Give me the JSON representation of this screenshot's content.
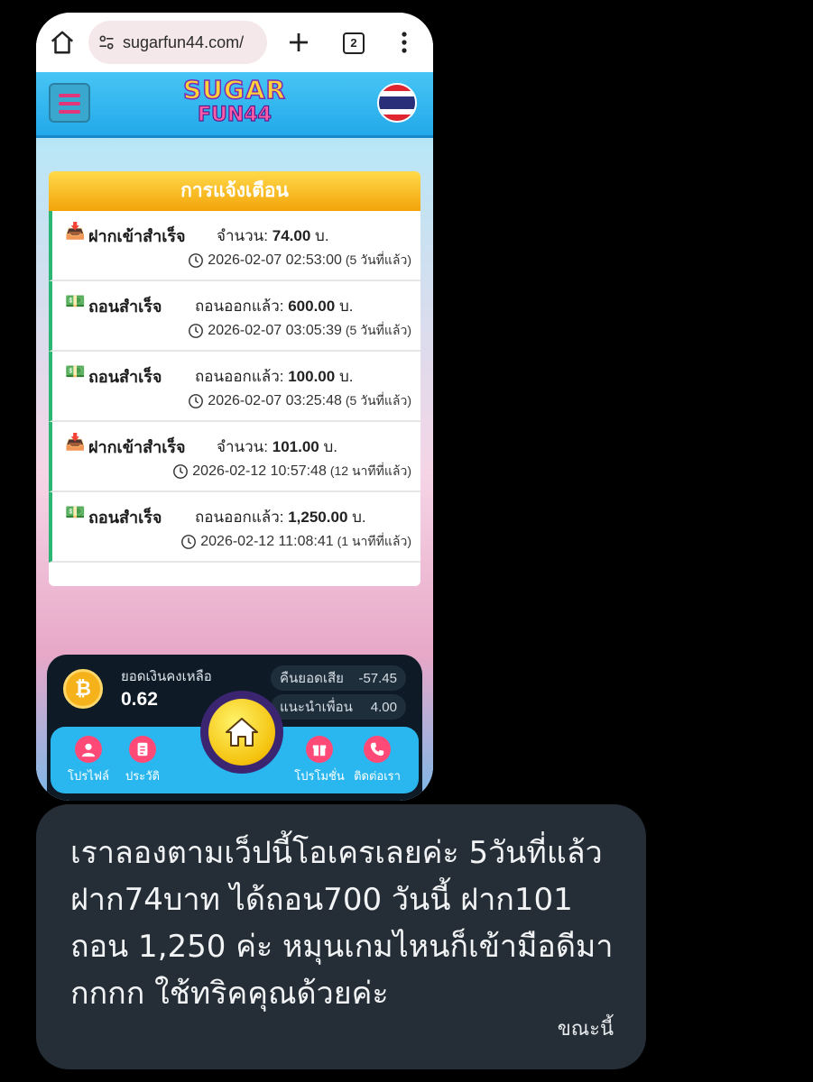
{
  "browser": {
    "url": "sugarfun44.com/",
    "tab_count": "2"
  },
  "site": {
    "logo_line1": "SUGAR",
    "logo_line2": "FUN44"
  },
  "notifications": {
    "title": "การแจ้งเตือน",
    "items": [
      {
        "emoji": "📥",
        "title": "ฝากเข้าสำเร็จ",
        "amount_label": "จำนวน:",
        "amount": "74.00",
        "unit": "บ.",
        "time": "2026-02-07 02:53:00",
        "ago": "(5 วันที่แล้ว)"
      },
      {
        "emoji": "💵",
        "title": "ถอนสำเร็จ",
        "amount_label": "ถอนออกแล้ว:",
        "amount": "600.00",
        "unit": "บ.",
        "time": "2026-02-07 03:05:39",
        "ago": "(5 วันที่แล้ว)"
      },
      {
        "emoji": "💵",
        "title": "ถอนสำเร็จ",
        "amount_label": "ถอนออกแล้ว:",
        "amount": "100.00",
        "unit": "บ.",
        "time": "2026-02-07 03:25:48",
        "ago": "(5 วันที่แล้ว)"
      },
      {
        "emoji": "📥",
        "title": "ฝากเข้าสำเร็จ",
        "amount_label": "จำนวน:",
        "amount": "101.00",
        "unit": "บ.",
        "time": "2026-02-12 10:57:48",
        "ago": "(12 นาทีที่แล้ว)"
      },
      {
        "emoji": "💵",
        "title": "ถอนสำเร็จ",
        "amount_label": "ถอนออกแล้ว:",
        "amount": "1,250.00",
        "unit": "บ.",
        "time": "2026-02-12 11:08:41",
        "ago": "(1 นาทีที่แล้ว)"
      }
    ]
  },
  "wallet": {
    "balance_label": "ยอดเงินคงเหลือ",
    "balance": "0.62",
    "cashback_label": "คืนยอดเสีย",
    "cashback_value": "-57.45",
    "referral_label": "แนะนำเพื่อน",
    "referral_value": "4.00",
    "coin_symbol": "₿"
  },
  "menu": {
    "profile": "โปรไฟล์",
    "history": "ประวัติ",
    "promotion": "โปรโมชั่น",
    "contact": "ติดต่อเรา"
  },
  "message": {
    "text": "เราลองตามเว็ปนี้โอเครเลยค่ะ 5วันที่แล้ว ฝาก74บาท ได้ถอน700 วันนี้ ฝาก101 ถอน 1,250 ค่ะ หมุนเกมไหนก็เข้ามือดีมากกกก ใช้ทริคคุณด้วยค่ะ",
    "time": "ขณะนี้"
  },
  "colors": {
    "accent_yellow": "#f3a40a",
    "success_green": "#2bb673",
    "header_blue": "#23a9ea",
    "bubble_bg": "#252e36"
  }
}
